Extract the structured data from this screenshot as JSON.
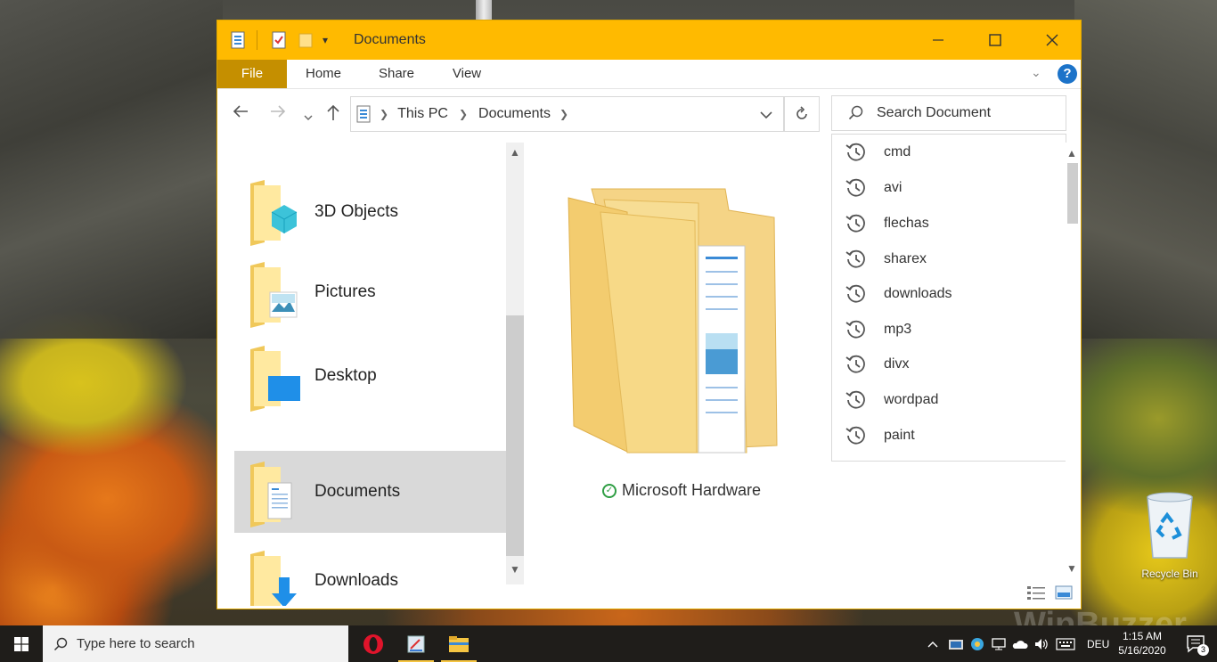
{
  "window": {
    "title": "Documents",
    "minimize_icon": "minimize-icon",
    "maximize_icon": "maximize-icon",
    "close_icon": "close-icon"
  },
  "ribbon": {
    "tabs": [
      "File",
      "Home",
      "Share",
      "View"
    ]
  },
  "address": {
    "segments": [
      "This PC",
      "Documents"
    ]
  },
  "search": {
    "placeholder": "Search Document"
  },
  "search_history": [
    "cmd",
    "avi",
    "flechas",
    "sharex",
    "downloads",
    "mp3",
    "divx",
    "wordpad",
    "paint"
  ],
  "nav_pane": {
    "items": [
      {
        "label": "3D Objects",
        "icon": "3d-objects-folder-icon",
        "selected": false
      },
      {
        "label": "Pictures",
        "icon": "pictures-folder-icon",
        "selected": false
      },
      {
        "label": "Desktop",
        "icon": "desktop-folder-icon",
        "selected": false
      },
      {
        "label": "Documents",
        "icon": "documents-folder-icon",
        "selected": true
      },
      {
        "label": "Downloads",
        "icon": "downloads-folder-icon",
        "selected": false
      }
    ]
  },
  "content": {
    "item_label": "Microsoft Hardware",
    "status_icon": "sync-ok-icon"
  },
  "desktop": {
    "recycle_bin_label": "Recycle Bin",
    "watermark": "WinBuzzer"
  },
  "taskbar": {
    "search_placeholder": "Type here to search",
    "language": "DEU",
    "time": "1:15 AM",
    "date": "5/16/2020",
    "notification_count": "3"
  },
  "colors": {
    "titlebar": "#ffba00",
    "file_tab": "#c58f00",
    "selection": "#d9d9d9",
    "accent_blue": "#1c73c9"
  }
}
